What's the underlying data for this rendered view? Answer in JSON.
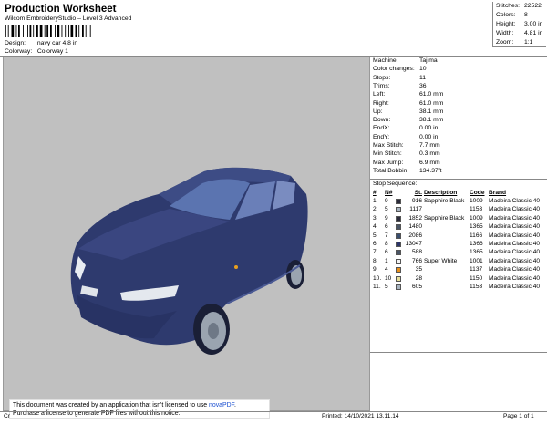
{
  "header": {
    "title": "Production Worksheet",
    "subtitle": "Wilcom EmbroideryStudio – Level 3 Advanced",
    "design_label": "Design:",
    "design_value": "navy car 4,8 in",
    "colorway_label": "Colorway:",
    "colorway_value": "Colorway 1"
  },
  "stats": [
    {
      "label": "Stitches:",
      "value": "22522"
    },
    {
      "label": "Colors:",
      "value": "8"
    },
    {
      "label": "Height:",
      "value": "3.00 in"
    },
    {
      "label": "Width:",
      "value": "4.81 in"
    },
    {
      "label": "Zoom:",
      "value": "1:1"
    }
  ],
  "machine_info": [
    {
      "label": "Machine:",
      "value": "Tajima"
    },
    {
      "label": "Color changes:",
      "value": "10"
    },
    {
      "label": "Stops:",
      "value": "11"
    },
    {
      "label": "Trims:",
      "value": "36"
    },
    {
      "label": "Left:",
      "value": "61.0 mm"
    },
    {
      "label": "Right:",
      "value": "61.0 mm"
    },
    {
      "label": "Up:",
      "value": "38.1 mm"
    },
    {
      "label": "Down:",
      "value": "38.1 mm"
    },
    {
      "label": "EndX:",
      "value": "0.00 in"
    },
    {
      "label": "EndY:",
      "value": "0.00 in"
    },
    {
      "label": "Max Stitch:",
      "value": "7.7 mm"
    },
    {
      "label": "Min Stitch:",
      "value": "0.3 mm"
    },
    {
      "label": "Max Jump:",
      "value": "6.9 mm"
    },
    {
      "label": "Total Bobbin:",
      "value": "134.37ft"
    }
  ],
  "stop_sequence_label": "Stop Sequence:",
  "stop_table": {
    "headers": {
      "idx": "#",
      "n": "N#",
      "st": "St.",
      "desc": "Description",
      "code": "Code",
      "brand": "Brand"
    },
    "rows": [
      {
        "idx": "1.",
        "n": "9",
        "color": "#2b2b3a",
        "st": "916",
        "desc": "Sapphire Black",
        "code": "1009",
        "brand": "Madeira Classic 40"
      },
      {
        "idx": "2.",
        "n": "5",
        "color": "#a8b4c0",
        "st": "1117",
        "desc": "",
        "code": "1153",
        "brand": "Madeira Classic 40"
      },
      {
        "idx": "3.",
        "n": "9",
        "color": "#2b2b3a",
        "st": "1852",
        "desc": "Sapphire Black",
        "code": "1009",
        "brand": "Madeira Classic 40"
      },
      {
        "idx": "4.",
        "n": "6",
        "color": "#4a5566",
        "st": "1480",
        "desc": "",
        "code": "1365",
        "brand": "Madeira Classic 40"
      },
      {
        "idx": "5.",
        "n": "7",
        "color": "#3a4e6e",
        "st": "2086",
        "desc": "",
        "code": "1166",
        "brand": "Madeira Classic 40"
      },
      {
        "idx": "6.",
        "n": "8",
        "color": "#2c3568",
        "st": "13047",
        "desc": "",
        "code": "1366",
        "brand": "Madeira Classic 40"
      },
      {
        "idx": "7.",
        "n": "6",
        "color": "#4a5566",
        "st": "588",
        "desc": "",
        "code": "1365",
        "brand": "Madeira Classic 40"
      },
      {
        "idx": "8.",
        "n": "1",
        "color": "#f4f4f4",
        "st": "766",
        "desc": "Super White",
        "code": "1001",
        "brand": "Madeira Classic 40"
      },
      {
        "idx": "9.",
        "n": "4",
        "color": "#e8901a",
        "st": "35",
        "desc": "",
        "code": "1137",
        "brand": "Madeira Classic 40"
      },
      {
        "idx": "10.",
        "n": "10",
        "color": "#e6df9a",
        "st": "28",
        "desc": "",
        "code": "1150",
        "brand": "Madeira Classic 40"
      },
      {
        "idx": "11.",
        "n": "5",
        "color": "#a8b4c0",
        "st": "605",
        "desc": "",
        "code": "1153",
        "brand": "Madeira Classic 40"
      }
    ]
  },
  "banner": {
    "line1_prefix": "This document was created by an application that isn't licensed to use ",
    "link": "novaPDF",
    "line1_suffix": ".",
    "line2": "Purchase a license to generate PDF files without this notice."
  },
  "footer": {
    "left": "Cr",
    "printed": "Printed: 14/10/2021 13.11.14",
    "page": "Page 1 of 1"
  }
}
